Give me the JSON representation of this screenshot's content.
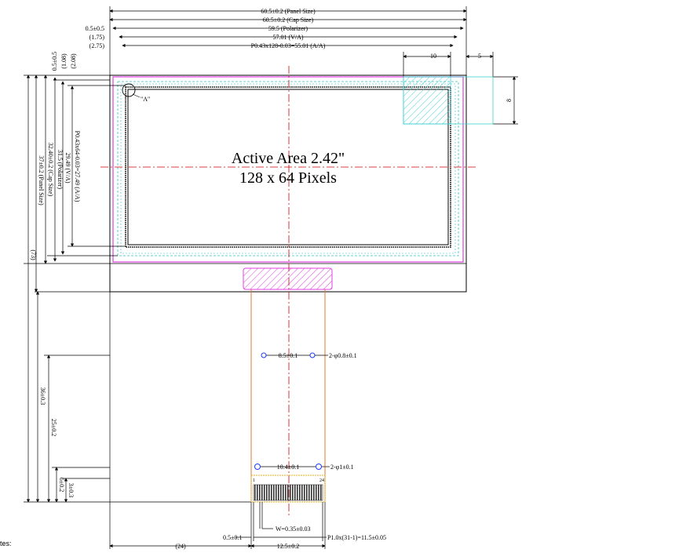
{
  "top_dims": {
    "panel_size": "60.5±0.2 (Panel Size)",
    "cap_size": "60.5±0.2 (Cap Size)",
    "polarizer": "59.5 (Polarizer)",
    "va": "57.01 (V/A)",
    "aa": "P0.43x128-0.03=55.01 (A/A)",
    "left_05": "0.5±0.5",
    "left_175": "(1.75)",
    "left_275": "(2.75)"
  },
  "right_dims": {
    "ten": "10",
    "five": "5",
    "eight": "8"
  },
  "left_dims": {
    "v05": "0.5±0.5",
    "v108": "(1.08)",
    "v208": "(2.08)",
    "aa": "P0.43x64-0.03=27.49 (A/A)",
    "va": "29.49 (V/A)",
    "polarizer": "31.5 (Polarizer)",
    "cap": "32.40±0.2 (Cap Size)",
    "panel": "37±0.2 (Panel Size)",
    "total": "(73)",
    "tail": "36±0.3",
    "tail2": "25±0.2",
    "tail3": "6±0.2",
    "tail4": "3±0.3"
  },
  "active_area": {
    "line1": "Active Area 2.42\"",
    "line2": "128 x 64 Pixels"
  },
  "detail_label": "\"A\"",
  "holes": {
    "upper_pitch": "8.5±0.1",
    "upper_hole": "2-φ0.8±0.1",
    "lower_pitch": "10.4±0.1",
    "lower_hole": "2-φ1±0.1"
  },
  "pins": {
    "first": "1",
    "last": "24"
  },
  "bottom_dims": {
    "width": "W=0.35±0.03",
    "offset": "0.5±0.1",
    "pitch": "P1.0x(31-1)=11.5±0.05",
    "tail_width": "12.5±0.2",
    "left_24": "(24)"
  },
  "notes_label": "tes:"
}
